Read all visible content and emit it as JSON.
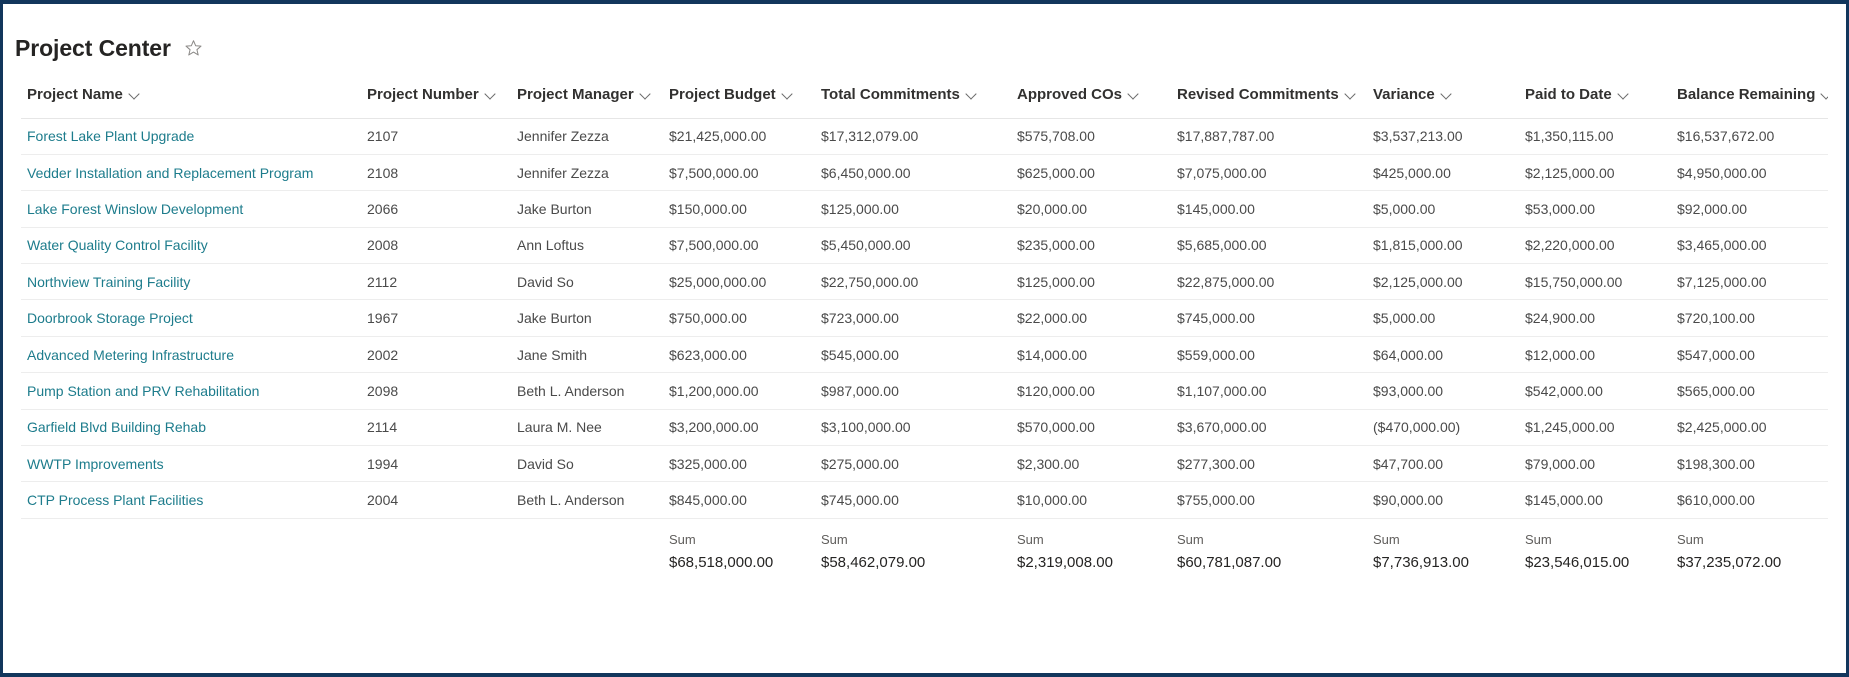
{
  "header": {
    "title": "Project Center",
    "favorite_icon": "star-outline-icon"
  },
  "table": {
    "sort_icon": "chevron-down-icon",
    "columns": [
      {
        "key": "project_name",
        "label": "Project Name"
      },
      {
        "key": "project_number",
        "label": "Project Number"
      },
      {
        "key": "project_manager",
        "label": "Project Manager"
      },
      {
        "key": "project_budget",
        "label": "Project Budget"
      },
      {
        "key": "total_commitments",
        "label": "Total Commitments"
      },
      {
        "key": "approved_cos",
        "label": "Approved COs"
      },
      {
        "key": "revised_commitments",
        "label": "Revised Commitments"
      },
      {
        "key": "variance",
        "label": "Variance"
      },
      {
        "key": "paid_to_date",
        "label": "Paid to Date"
      },
      {
        "key": "balance_remaining",
        "label": "Balance Remaining"
      }
    ],
    "rows": [
      {
        "project_name": "Forest Lake Plant Upgrade",
        "project_number": "2107",
        "project_manager": "Jennifer Zezza",
        "project_budget": "$21,425,000.00",
        "total_commitments": "$17,312,079.00",
        "approved_cos": "$575,708.00",
        "revised_commitments": "$17,887,787.00",
        "variance": "$3,537,213.00",
        "paid_to_date": "$1,350,115.00",
        "balance_remaining": "$16,537,672.00"
      },
      {
        "project_name": "Vedder Installation and Replacement Program",
        "project_number": "2108",
        "project_manager": "Jennifer Zezza",
        "project_budget": "$7,500,000.00",
        "total_commitments": "$6,450,000.00",
        "approved_cos": "$625,000.00",
        "revised_commitments": "$7,075,000.00",
        "variance": "$425,000.00",
        "paid_to_date": "$2,125,000.00",
        "balance_remaining": "$4,950,000.00"
      },
      {
        "project_name": "Lake Forest Winslow Development",
        "project_number": "2066",
        "project_manager": "Jake Burton",
        "project_budget": "$150,000.00",
        "total_commitments": "$125,000.00",
        "approved_cos": "$20,000.00",
        "revised_commitments": "$145,000.00",
        "variance": "$5,000.00",
        "paid_to_date": "$53,000.00",
        "balance_remaining": "$92,000.00"
      },
      {
        "project_name": "Water Quality Control Facility",
        "project_number": "2008",
        "project_manager": "Ann Loftus",
        "project_budget": "$7,500,000.00",
        "total_commitments": "$5,450,000.00",
        "approved_cos": "$235,000.00",
        "revised_commitments": "$5,685,000.00",
        "variance": "$1,815,000.00",
        "paid_to_date": "$2,220,000.00",
        "balance_remaining": "$3,465,000.00"
      },
      {
        "project_name": "Northview Training Facility",
        "project_number": "2112",
        "project_manager": "David So",
        "project_budget": "$25,000,000.00",
        "total_commitments": "$22,750,000.00",
        "approved_cos": "$125,000.00",
        "revised_commitments": "$22,875,000.00",
        "variance": "$2,125,000.00",
        "paid_to_date": "$15,750,000.00",
        "balance_remaining": "$7,125,000.00"
      },
      {
        "project_name": "Doorbrook Storage Project",
        "project_number": "1967",
        "project_manager": "Jake Burton",
        "project_budget": "$750,000.00",
        "total_commitments": "$723,000.00",
        "approved_cos": "$22,000.00",
        "revised_commitments": "$745,000.00",
        "variance": "$5,000.00",
        "paid_to_date": "$24,900.00",
        "balance_remaining": "$720,100.00"
      },
      {
        "project_name": "Advanced Metering Infrastructure",
        "project_number": "2002",
        "project_manager": "Jane Smith",
        "project_budget": "$623,000.00",
        "total_commitments": "$545,000.00",
        "approved_cos": "$14,000.00",
        "revised_commitments": "$559,000.00",
        "variance": "$64,000.00",
        "paid_to_date": "$12,000.00",
        "balance_remaining": "$547,000.00"
      },
      {
        "project_name": "Pump Station and PRV Rehabilitation",
        "project_number": "2098",
        "project_manager": "Beth L. Anderson",
        "project_budget": "$1,200,000.00",
        "total_commitments": "$987,000.00",
        "approved_cos": "$120,000.00",
        "revised_commitments": "$1,107,000.00",
        "variance": "$93,000.00",
        "paid_to_date": "$542,000.00",
        "balance_remaining": "$565,000.00"
      },
      {
        "project_name": "Garfield Blvd Building Rehab",
        "project_number": "2114",
        "project_manager": "Laura M. Nee",
        "project_budget": "$3,200,000.00",
        "total_commitments": "$3,100,000.00",
        "approved_cos": "$570,000.00",
        "revised_commitments": "$3,670,000.00",
        "variance": "($470,000.00)",
        "paid_to_date": "$1,245,000.00",
        "balance_remaining": "$2,425,000.00"
      },
      {
        "project_name": "WWTP Improvements",
        "project_number": "1994",
        "project_manager": "David So",
        "project_budget": "$325,000.00",
        "total_commitments": "$275,000.00",
        "approved_cos": "$2,300.00",
        "revised_commitments": "$277,300.00",
        "variance": "$47,700.00",
        "paid_to_date": "$79,000.00",
        "balance_remaining": "$198,300.00"
      },
      {
        "project_name": "CTP Process Plant Facilities",
        "project_number": "2004",
        "project_manager": "Beth L. Anderson",
        "project_budget": "$845,000.00",
        "total_commitments": "$745,000.00",
        "approved_cos": "$10,000.00",
        "revised_commitments": "$755,000.00",
        "variance": "$90,000.00",
        "paid_to_date": "$145,000.00",
        "balance_remaining": "$610,000.00"
      }
    ],
    "summary": {
      "label": "Sum",
      "project_budget": "$68,518,000.00",
      "total_commitments": "$58,462,079.00",
      "approved_cos": "$2,319,008.00",
      "revised_commitments": "$60,781,087.00",
      "variance": "$7,736,913.00",
      "paid_to_date": "$23,546,015.00",
      "balance_remaining": "$37,235,072.00"
    }
  },
  "colors": {
    "frame_border": "#12365c",
    "link": "#1d7c8c",
    "title": "#252423",
    "cell_text": "#4a4a4a"
  }
}
